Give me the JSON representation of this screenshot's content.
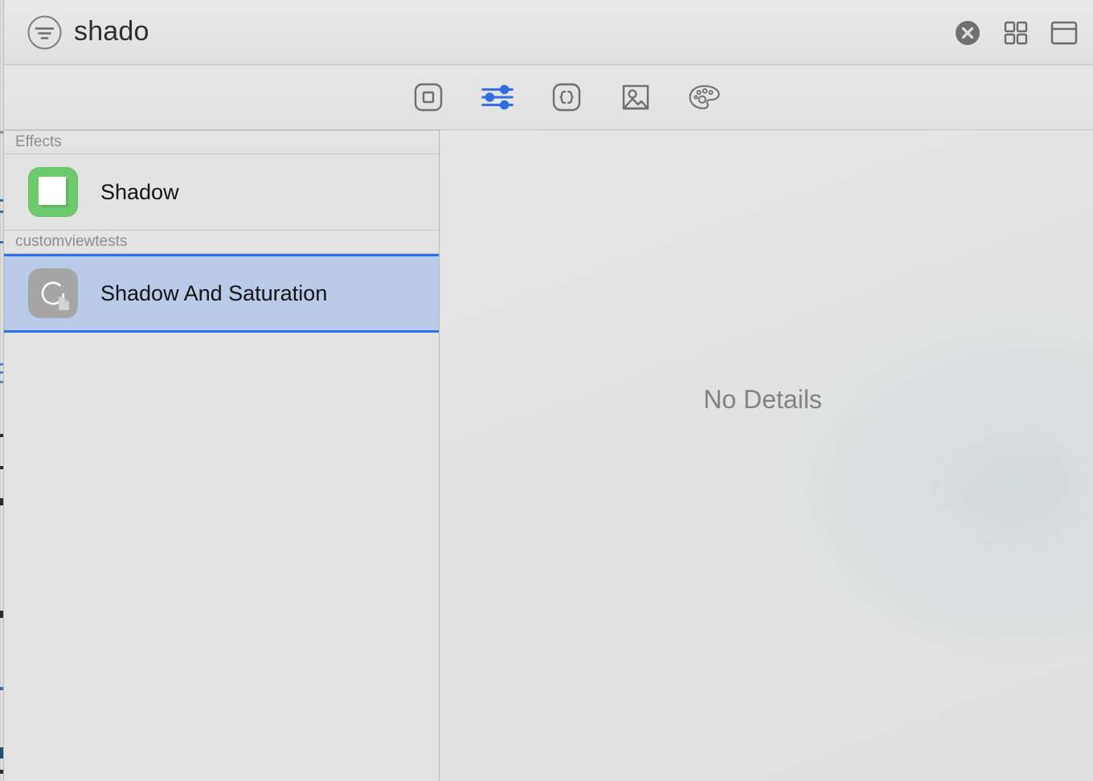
{
  "window": {
    "title": "shado",
    "filter_icon": "filter-circle-icon"
  },
  "titlebar_buttons": [
    {
      "name": "clear-search-button",
      "icon": "close-circle-icon",
      "label": "Clear"
    },
    {
      "name": "grid-view-button",
      "icon": "grid-view-icon",
      "label": "Grid View"
    },
    {
      "name": "layout-view-button",
      "icon": "window-layout-icon",
      "label": "Layout View"
    }
  ],
  "toolbar": {
    "items": [
      {
        "name": "tab-general",
        "icon": "rounded-square-icon",
        "label": "General",
        "active": false
      },
      {
        "name": "tab-attributes",
        "icon": "sliders-icon",
        "label": "Attributes",
        "active": true
      },
      {
        "name": "tab-code",
        "icon": "braces-icon",
        "label": "Code",
        "active": false
      },
      {
        "name": "tab-media",
        "icon": "image-icon",
        "label": "Media",
        "active": false
      },
      {
        "name": "tab-colors",
        "icon": "palette-icon",
        "label": "Colors",
        "active": false
      }
    ]
  },
  "sidebar": {
    "groups": [
      {
        "header": "Effects",
        "rows": [
          {
            "label": "Shadow",
            "icon": "shadow-effect-icon",
            "selected": false
          }
        ]
      },
      {
        "header": "customviewtests",
        "rows": [
          {
            "label": "Shadow And Saturation",
            "icon": "shadow-saturation-icon",
            "selected": true
          }
        ]
      }
    ]
  },
  "detail": {
    "empty_message": "No Details"
  },
  "colors": {
    "accent_blue": "#2a72e4",
    "selection_blue": "#b9cbe8",
    "effect_green": "#6cc96c",
    "icon_gray": "#6b6b6b",
    "window_bg": "#e3e3e3"
  }
}
